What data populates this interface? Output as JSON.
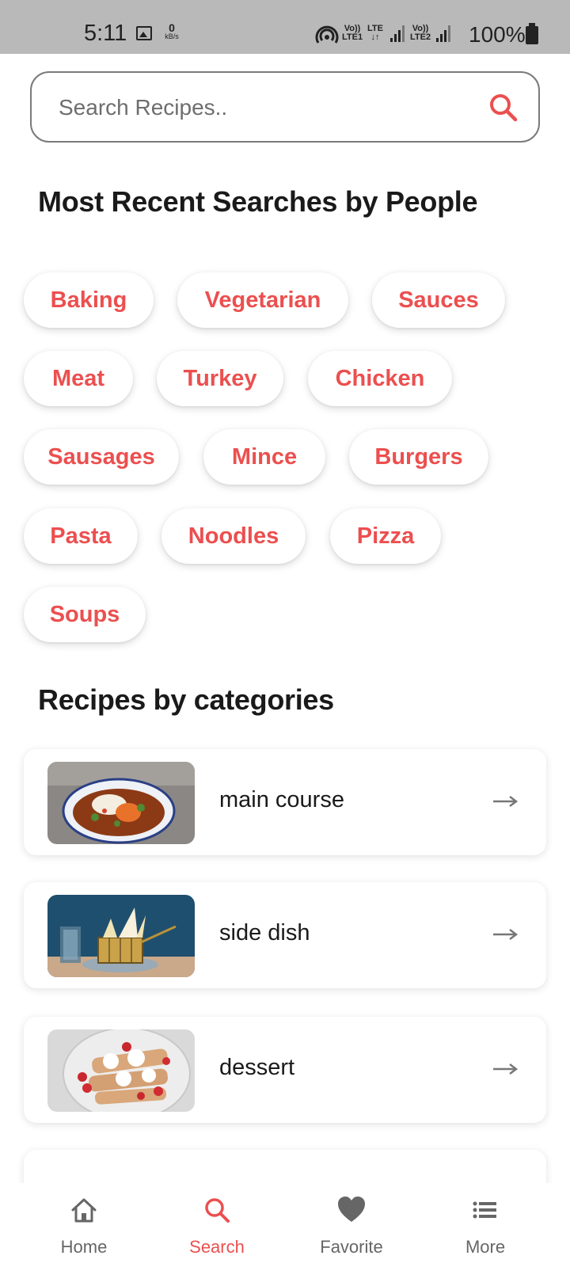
{
  "status_bar": {
    "time": "5:11",
    "speed_value": "0",
    "speed_unit": "kB/s",
    "sim1_top": "Vo))",
    "sim1_bottom": "LTE1",
    "lte_top": "LTE",
    "lte_bottom": "↓↑",
    "sim2_top": "Vo))",
    "sim2_bottom": "LTE2",
    "battery_percent": "100%"
  },
  "search": {
    "placeholder": "Search Recipes.."
  },
  "recent_searches": {
    "title": "Most Recent Searches by People",
    "chips": [
      "Baking",
      "Vegetarian",
      "Sauces",
      "Meat",
      "Turkey",
      "Chicken",
      "Sausages",
      "Mince",
      "Burgers",
      "Pasta",
      "Noodles",
      "Pizza",
      "Soups"
    ]
  },
  "categories": {
    "title": "Recipes by categories",
    "items": [
      {
        "label": "main course"
      },
      {
        "label": "side dish"
      },
      {
        "label": "dessert"
      }
    ]
  },
  "bottom_nav": {
    "items": [
      {
        "label": "Home",
        "icon": "home-icon"
      },
      {
        "label": "Search",
        "icon": "search-icon",
        "active": true
      },
      {
        "label": "Favorite",
        "icon": "heart-icon"
      },
      {
        "label": "More",
        "icon": "menu-icon"
      }
    ]
  },
  "colors": {
    "accent": "#ec4f4f",
    "status_bar": "#b9b9b9",
    "nav_inactive": "#666666"
  }
}
